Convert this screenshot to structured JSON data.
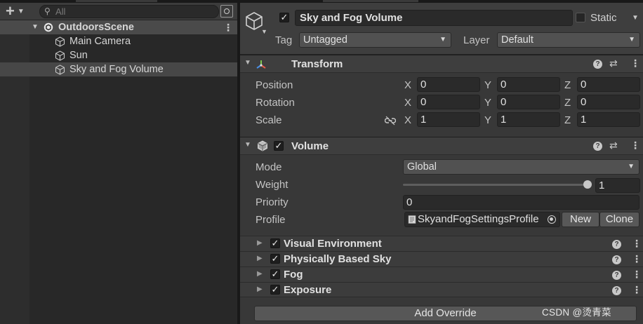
{
  "hierarchy": {
    "search_placeholder": "All",
    "scene_name": "OutdoorsScene",
    "items": [
      {
        "label": "Main Camera"
      },
      {
        "label": "Sun"
      },
      {
        "label": "Sky and Fog Volume"
      }
    ]
  },
  "inspector": {
    "object_name": "Sky and Fog Volume",
    "static_label": "Static",
    "tag_label": "Tag",
    "tag_value": "Untagged",
    "layer_label": "Layer",
    "layer_value": "Default",
    "transform": {
      "title": "Transform",
      "rows": [
        {
          "label": "Position",
          "x": "0",
          "y": "0",
          "z": "0"
        },
        {
          "label": "Rotation",
          "x": "0",
          "y": "0",
          "z": "0"
        },
        {
          "label": "Scale",
          "x": "1",
          "y": "1",
          "z": "1"
        }
      ],
      "axis_x": "X",
      "axis_y": "Y",
      "axis_z": "Z"
    },
    "volume": {
      "title": "Volume",
      "mode_label": "Mode",
      "mode_value": "Global",
      "weight_label": "Weight",
      "weight_value": "1",
      "priority_label": "Priority",
      "priority_value": "0",
      "profile_label": "Profile",
      "profile_value": "SkyandFogSettingsProfile",
      "new_label": "New",
      "clone_label": "Clone"
    },
    "overrides": [
      {
        "title": "Visual Environment"
      },
      {
        "title": "Physically Based Sky"
      },
      {
        "title": "Fog"
      },
      {
        "title": "Exposure"
      }
    ],
    "add_override_label": "Add Override"
  },
  "watermark": "CSDN @烫青菜"
}
